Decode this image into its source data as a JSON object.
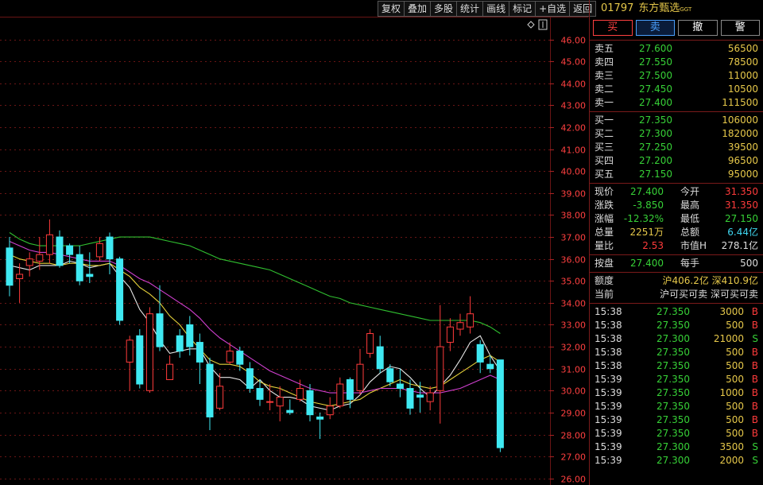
{
  "toolbar": [
    "复权",
    "叠加",
    "多股",
    "统计",
    "画线",
    "标记",
    "+自选",
    "返回"
  ],
  "stock": {
    "code": "01797",
    "name": "东方甄选",
    "sub": "GGT"
  },
  "actions": [
    "买",
    "卖",
    "撤",
    "警"
  ],
  "asks": [
    {
      "label": "卖五",
      "price": "27.600",
      "vol": "56500"
    },
    {
      "label": "卖四",
      "price": "27.550",
      "vol": "78500"
    },
    {
      "label": "卖三",
      "price": "27.500",
      "vol": "11000"
    },
    {
      "label": "卖二",
      "price": "27.450",
      "vol": "10500"
    },
    {
      "label": "卖一",
      "price": "27.400",
      "vol": "111500"
    }
  ],
  "bids": [
    {
      "label": "买一",
      "price": "27.350",
      "vol": "106000"
    },
    {
      "label": "买二",
      "price": "27.300",
      "vol": "182000"
    },
    {
      "label": "买三",
      "price": "27.250",
      "vol": "39500"
    },
    {
      "label": "买四",
      "price": "27.200",
      "vol": "96500"
    },
    {
      "label": "买五",
      "price": "27.150",
      "vol": "95000"
    }
  ],
  "quote": [
    {
      "l1": "现价",
      "v1": "27.400",
      "l2": "今开",
      "v2": "31.350",
      "c1": "green",
      "c2": "red"
    },
    {
      "l1": "涨跌",
      "v1": "-3.850",
      "l2": "最高",
      "v2": "31.350",
      "c1": "green",
      "c2": "red"
    },
    {
      "l1": "涨幅",
      "v1": "-12.32%",
      "l2": "最低",
      "v2": "27.150",
      "c1": "green",
      "c2": "green"
    },
    {
      "l1": "总量",
      "v1": "2251万",
      "l2": "总额",
      "v2": "6.44亿",
      "c1": "yellow",
      "c2": "cyan"
    },
    {
      "l1": "量比",
      "v1": "2.53",
      "l2": "市值H",
      "v2": "278.1亿",
      "c1": "red",
      "c2": "white"
    }
  ],
  "extra": {
    "l1": "按盘",
    "v1": "27.400",
    "l2": "每手",
    "v2": "500"
  },
  "quota": {
    "l1": "额度",
    "v1": "沪406.2亿 深410.9亿",
    "l2": "当前",
    "v2": "沪可买可卖 深可买可卖"
  },
  "ticks": [
    {
      "t": "15:38",
      "p": "27.350",
      "v": "3000",
      "d": "B"
    },
    {
      "t": "15:38",
      "p": "27.350",
      "v": "500",
      "d": "B"
    },
    {
      "t": "15:38",
      "p": "27.300",
      "v": "21000",
      "d": "S"
    },
    {
      "t": "15:38",
      "p": "27.350",
      "v": "500",
      "d": "B"
    },
    {
      "t": "15:38",
      "p": "27.350",
      "v": "500",
      "d": "B"
    },
    {
      "t": "15:39",
      "p": "27.350",
      "v": "500",
      "d": "B"
    },
    {
      "t": "15:39",
      "p": "27.350",
      "v": "1000",
      "d": "B"
    },
    {
      "t": "15:39",
      "p": "27.350",
      "v": "500",
      "d": "B"
    },
    {
      "t": "15:39",
      "p": "27.350",
      "v": "500",
      "d": "B"
    },
    {
      "t": "15:39",
      "p": "27.350",
      "v": "500",
      "d": "B"
    },
    {
      "t": "15:39",
      "p": "27.300",
      "v": "3500",
      "d": "S"
    },
    {
      "t": "15:39",
      "p": "27.300",
      "v": "2000",
      "d": "S"
    }
  ],
  "colors": {
    "up": "#ff3b3b",
    "down": "#3fe9f2",
    "ma_white": "#e8e8e8",
    "ma_yellow": "#e6d23a",
    "ma_magenta": "#d040d0",
    "ma_green": "#30c030",
    "grid": "#6a1515"
  },
  "chart_data": {
    "type": "candlestick",
    "ylim": [
      25.7,
      47.0
    ],
    "yticks": [
      "46.00",
      "45.00",
      "44.00",
      "43.00",
      "42.00",
      "41.00",
      "40.00",
      "39.00",
      "38.00",
      "37.00",
      "36.00",
      "35.00",
      "34.00",
      "33.00",
      "32.00",
      "31.00",
      "30.00",
      "29.00",
      "28.00",
      "27.00",
      "26.00"
    ],
    "candles": [
      {
        "o": 36.5,
        "c": 34.8,
        "h": 37.0,
        "l": 34.3
      },
      {
        "o": 35.1,
        "c": 35.3,
        "h": 35.8,
        "l": 34.0
      },
      {
        "o": 35.7,
        "c": 36.0,
        "h": 36.3,
        "l": 35.2
      },
      {
        "o": 35.9,
        "c": 36.2,
        "h": 37.0,
        "l": 35.5
      },
      {
        "o": 36.2,
        "c": 37.1,
        "h": 37.8,
        "l": 35.8
      },
      {
        "o": 37.0,
        "c": 35.7,
        "h": 37.3,
        "l": 35.6
      },
      {
        "o": 36.6,
        "c": 36.2,
        "h": 36.7,
        "l": 35.8
      },
      {
        "o": 36.2,
        "c": 35.0,
        "h": 36.6,
        "l": 34.8
      },
      {
        "o": 35.3,
        "c": 35.2,
        "h": 36.3,
        "l": 34.9
      },
      {
        "o": 36.1,
        "c": 36.7,
        "h": 37.0,
        "l": 35.9
      },
      {
        "o": 37.0,
        "c": 36.0,
        "h": 37.2,
        "l": 35.3
      },
      {
        "o": 36.0,
        "c": 33.2,
        "h": 36.1,
        "l": 33.0
      },
      {
        "o": 31.3,
        "c": 32.3,
        "h": 32.5,
        "l": 30.0
      },
      {
        "o": 32.5,
        "c": 30.3,
        "h": 32.8,
        "l": 30.1
      },
      {
        "o": 30.0,
        "c": 33.5,
        "h": 33.8,
        "l": 29.9
      },
      {
        "o": 33.5,
        "c": 32.0,
        "h": 34.8,
        "l": 31.8
      },
      {
        "o": 30.5,
        "c": 31.2,
        "h": 31.6,
        "l": 30.5
      },
      {
        "o": 32.5,
        "c": 31.8,
        "h": 32.8,
        "l": 31.5
      },
      {
        "o": 33.0,
        "c": 32.0,
        "h": 33.4,
        "l": 31.6
      },
      {
        "o": 32.2,
        "c": 31.3,
        "h": 32.6,
        "l": 30.3
      },
      {
        "o": 31.2,
        "c": 28.8,
        "h": 31.5,
        "l": 28.2
      },
      {
        "o": 29.2,
        "c": 30.2,
        "h": 30.8,
        "l": 29.1
      },
      {
        "o": 31.3,
        "c": 31.8,
        "h": 32.2,
        "l": 31.2
      },
      {
        "o": 31.8,
        "c": 31.2,
        "h": 32.0,
        "l": 30.9
      },
      {
        "o": 31.0,
        "c": 30.1,
        "h": 31.3,
        "l": 29.9
      },
      {
        "o": 30.1,
        "c": 29.6,
        "h": 30.5,
        "l": 29.3
      },
      {
        "o": 29.5,
        "c": 29.5,
        "h": 30.3,
        "l": 29.1
      },
      {
        "o": 29.3,
        "c": 29.7,
        "h": 30.2,
        "l": 28.6
      },
      {
        "o": 29.1,
        "c": 29.0,
        "h": 29.6,
        "l": 28.9
      },
      {
        "o": 29.6,
        "c": 30.1,
        "h": 30.5,
        "l": 29.5
      },
      {
        "o": 30.0,
        "c": 28.9,
        "h": 30.3,
        "l": 28.6
      },
      {
        "o": 28.8,
        "c": 28.7,
        "h": 29.0,
        "l": 27.8
      },
      {
        "o": 28.9,
        "c": 29.3,
        "h": 29.7,
        "l": 28.7
      },
      {
        "o": 29.3,
        "c": 30.3,
        "h": 30.6,
        "l": 29.2
      },
      {
        "o": 30.5,
        "c": 29.6,
        "h": 30.6,
        "l": 29.2
      },
      {
        "o": 30.0,
        "c": 31.2,
        "h": 31.9,
        "l": 29.8
      },
      {
        "o": 31.7,
        "c": 32.6,
        "h": 32.8,
        "l": 31.5
      },
      {
        "o": 32.0,
        "c": 31.0,
        "h": 32.5,
        "l": 30.8
      },
      {
        "o": 31.0,
        "c": 30.4,
        "h": 31.2,
        "l": 30.2
      },
      {
        "o": 30.3,
        "c": 30.1,
        "h": 31.0,
        "l": 29.7
      },
      {
        "o": 30.1,
        "c": 29.2,
        "h": 30.5,
        "l": 28.9
      },
      {
        "o": 29.8,
        "c": 29.7,
        "h": 30.4,
        "l": 29.0
      },
      {
        "o": 29.5,
        "c": 29.9,
        "h": 30.2,
        "l": 29.1
      },
      {
        "o": 30.0,
        "c": 32.0,
        "h": 33.9,
        "l": 28.5
      },
      {
        "o": 32.2,
        "c": 32.9,
        "h": 33.3,
        "l": 31.8
      },
      {
        "o": 32.8,
        "c": 33.1,
        "h": 33.5,
        "l": 32.5
      },
      {
        "o": 32.9,
        "c": 33.5,
        "h": 34.3,
        "l": 32.6
      },
      {
        "o": 32.1,
        "c": 31.3,
        "h": 32.3,
        "l": 30.8
      },
      {
        "o": 31.2,
        "c": 31.0,
        "h": 31.6,
        "l": 30.8
      },
      {
        "o": 31.4,
        "c": 27.4,
        "h": 31.4,
        "l": 27.2
      }
    ],
    "ma": [
      {
        "color": "ma_white",
        "values": [
          35.7,
          35.6,
          35.5,
          35.7,
          35.7,
          35.7,
          35.9,
          35.8,
          35.6,
          35.7,
          35.8,
          35.2,
          34.7,
          33.7,
          33.1,
          32.3,
          31.7,
          31.8,
          31.9,
          31.9,
          31.1,
          30.6,
          30.6,
          30.5,
          30.1,
          30.5,
          30.0,
          29.7,
          29.7,
          29.6,
          29.3,
          29.2,
          29.1,
          29.3,
          29.4,
          29.8,
          30.4,
          30.8,
          31.1,
          31.0,
          30.6,
          30.1,
          29.7,
          30.2,
          30.7,
          31.4,
          32.2,
          32.5,
          31.6,
          30.9
        ]
      },
      {
        "color": "ma_yellow",
        "values": [
          36.2,
          36.0,
          35.9,
          35.8,
          35.8,
          35.7,
          35.8,
          35.8,
          35.7,
          35.7,
          35.8,
          35.5,
          35.2,
          34.7,
          34.4,
          34.0,
          33.4,
          33.0,
          32.4,
          31.9,
          31.4,
          31.2,
          31.2,
          31.1,
          30.8,
          30.4,
          30.2,
          30.1,
          29.9,
          29.7,
          29.5,
          29.4,
          29.3,
          29.4,
          29.5,
          29.6,
          29.9,
          30.1,
          30.3,
          30.5,
          30.3,
          30.2,
          30.1,
          30.2,
          30.5,
          30.8,
          31.1,
          31.4,
          31.6,
          31.3
        ]
      },
      {
        "color": "ma_magenta",
        "values": [
          36.8,
          36.6,
          36.4,
          36.3,
          36.3,
          36.2,
          36.1,
          36.0,
          35.9,
          35.9,
          35.9,
          35.7,
          35.4,
          35.1,
          34.9,
          34.6,
          34.3,
          34.0,
          33.7,
          33.3,
          32.8,
          32.4,
          32.1,
          31.8,
          31.5,
          31.2,
          30.9,
          30.7,
          30.5,
          30.3,
          30.1,
          30.0,
          29.9,
          29.9,
          29.9,
          29.9,
          30.0,
          30.1,
          30.1,
          30.1,
          30.0,
          29.9,
          29.9,
          29.9,
          30.0,
          30.1,
          30.3,
          30.5,
          30.7,
          30.5
        ]
      },
      {
        "color": "ma_green",
        "values": [
          37.2,
          36.9,
          36.7,
          36.6,
          36.6,
          36.6,
          36.6,
          36.6,
          36.7,
          36.8,
          36.9,
          37.0,
          37.0,
          37.0,
          37.0,
          36.9,
          36.8,
          36.7,
          36.6,
          36.4,
          36.2,
          36.0,
          35.9,
          35.8,
          35.7,
          35.6,
          35.5,
          35.3,
          35.1,
          34.9,
          34.7,
          34.5,
          34.3,
          34.2,
          34.0,
          33.9,
          33.8,
          33.7,
          33.6,
          33.5,
          33.4,
          33.3,
          33.2,
          33.2,
          33.2,
          33.2,
          33.2,
          33.1,
          32.9,
          32.6
        ]
      }
    ]
  }
}
